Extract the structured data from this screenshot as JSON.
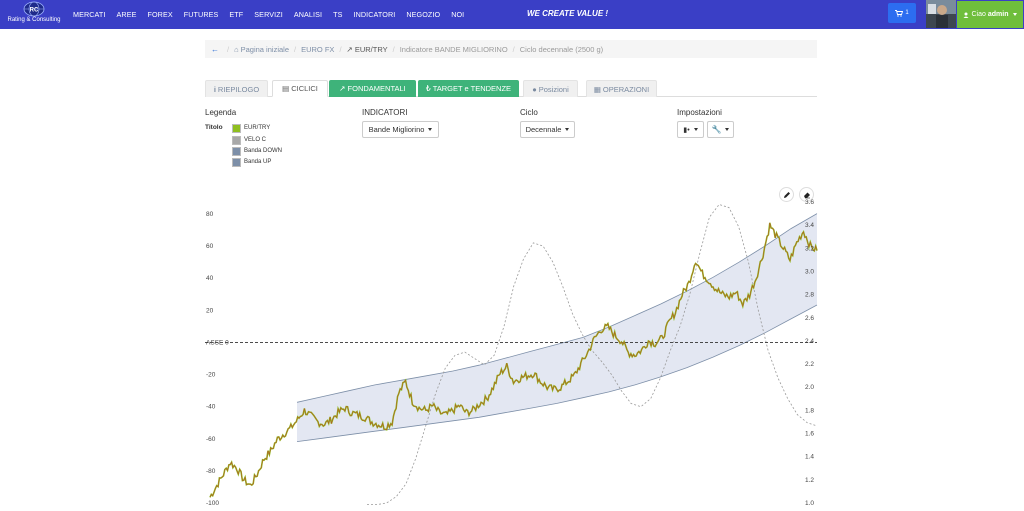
{
  "brand": {
    "name": "Rating & Consulting"
  },
  "nav": [
    "MERCATI",
    "AREE",
    "FOREX",
    "FUTURES",
    "ETF",
    "SERVIZI",
    "ANALISI",
    "TS",
    "INDICATORI",
    "NEGOZIO",
    "NOI"
  ],
  "slogan": "WE CREATE VALUE !",
  "cart": {
    "count": "1"
  },
  "user": {
    "greeting": "Ciao",
    "name": "admin"
  },
  "breadcrumb": {
    "home": "Pagina iniziale",
    "group": "EURO FX",
    "pair": "EUR/TRY",
    "indicator": "Indicatore BANDE MIGLIORINO",
    "cycle": "Ciclo decennale (2500 g)"
  },
  "tabs": [
    {
      "label": "RIEPILOGO",
      "icon": "info-icon"
    },
    {
      "label": "CICLICI",
      "icon": "bar-chart-icon"
    },
    {
      "label": "FONDAMENTALI",
      "icon": "line-chart-icon"
    },
    {
      "label": "TARGET e TENDENZE",
      "icon": "lira-icon"
    },
    {
      "label": "Posizioni",
      "icon": "bomb-icon"
    },
    {
      "label": "OPERAZIONI",
      "icon": "calculator-icon"
    }
  ],
  "legend": {
    "label": "Legenda",
    "title": "Titolo",
    "items": [
      {
        "name": "EUR/TRY",
        "color": "#8fbf1f"
      },
      {
        "name": "VELO C",
        "color": "#a8a8a8"
      },
      {
        "name": "Banda DOWN",
        "color": "#7d8fa8"
      },
      {
        "name": "Banda UP",
        "color": "#7d8fa8"
      }
    ]
  },
  "indicators": {
    "label": "INDICATORI",
    "value": "Bande Migliorino"
  },
  "cycle": {
    "label": "Ciclo",
    "value": "Decennale"
  },
  "settings": {
    "label": "Impostazioni"
  },
  "chart_data": {
    "type": "line",
    "title": "",
    "left_axis": {
      "ticks": [
        "80",
        "60",
        "40",
        "20",
        "ASSE 0",
        "-20",
        "-40",
        "-60",
        "-80",
        "-100"
      ]
    },
    "right_axis": {
      "ticks": [
        "3.6",
        "3.4",
        "3.2",
        "3.0",
        "2.8",
        "2.6",
        "2.4",
        "2.2",
        "2.0",
        "1.8",
        "1.6",
        "1.4",
        "1.2",
        "1.0"
      ],
      "ylim": [
        1.0,
        3.6
      ]
    },
    "reference_line": {
      "label": "ASSE 0",
      "value": 0
    },
    "series": [
      {
        "name": "EUR/TRY",
        "axis": "right",
        "color": "#8fbf1f",
        "values": [
          1.05,
          1.15,
          1.25,
          1.35,
          1.3,
          1.2,
          1.15,
          1.25,
          1.38,
          1.45,
          1.55,
          1.6,
          1.65,
          1.72,
          1.8,
          1.75,
          1.7,
          1.68,
          1.72,
          1.78,
          1.82,
          1.78,
          1.76,
          1.74,
          1.7,
          1.68,
          1.66,
          1.7,
          1.95,
          2.05,
          1.88,
          1.82,
          1.8,
          1.84,
          1.78,
          1.76,
          1.8,
          1.84,
          1.78,
          1.8,
          1.86,
          1.9,
          2.0,
          2.12,
          2.18,
          2.05,
          2.08,
          2.1,
          2.12,
          2.05,
          2.0,
          1.98,
          2.0,
          2.05,
          2.1,
          2.2,
          2.3,
          2.42,
          2.5,
          2.52,
          2.45,
          2.4,
          2.3,
          2.28,
          2.32,
          2.4,
          2.38,
          2.42,
          2.55,
          2.65,
          2.8,
          2.9,
          3.1,
          2.98,
          2.92,
          2.85,
          2.8,
          2.78,
          2.82,
          2.72,
          2.8,
          2.95,
          3.15,
          3.4,
          3.3,
          3.2,
          3.1,
          3.25,
          3.35,
          3.22,
          3.18
        ]
      },
      {
        "name": "VELO C",
        "axis": "left",
        "color": "#a8a8a8",
        "values": [
          -101,
          -101,
          -100,
          -96,
          -88,
          -72,
          -52,
          -32,
          -16,
          -8,
          -6,
          -10,
          -14,
          -8,
          10,
          35,
          52,
          62,
          60,
          50,
          35,
          18,
          5,
          -5,
          -12,
          -20,
          -30,
          -38,
          -40,
          -35,
          -22,
          -5,
          10,
          30,
          55,
          78,
          86,
          84,
          72,
          50,
          20,
          -5,
          -22,
          -35,
          -45,
          -50,
          -52
        ]
      },
      {
        "name": "Banda DOWN",
        "axis": "right",
        "color": "#7d8fa8",
        "values": [
          1.53,
          1.56,
          1.59,
          1.62,
          1.65,
          1.68,
          1.71,
          1.74,
          1.78,
          1.82,
          1.86,
          1.91,
          1.96,
          2.02,
          2.09,
          2.17,
          2.26,
          2.36,
          2.47,
          2.59,
          2.71
        ]
      },
      {
        "name": "Banda UP",
        "axis": "right",
        "color": "#7d8fa8",
        "values": [
          1.87,
          1.92,
          1.97,
          2.02,
          2.06,
          2.1,
          2.14,
          2.19,
          2.25,
          2.31,
          2.37,
          2.43,
          2.52,
          2.62,
          2.72,
          2.83,
          2.95,
          3.08,
          3.22,
          3.37,
          3.5
        ]
      }
    ]
  }
}
